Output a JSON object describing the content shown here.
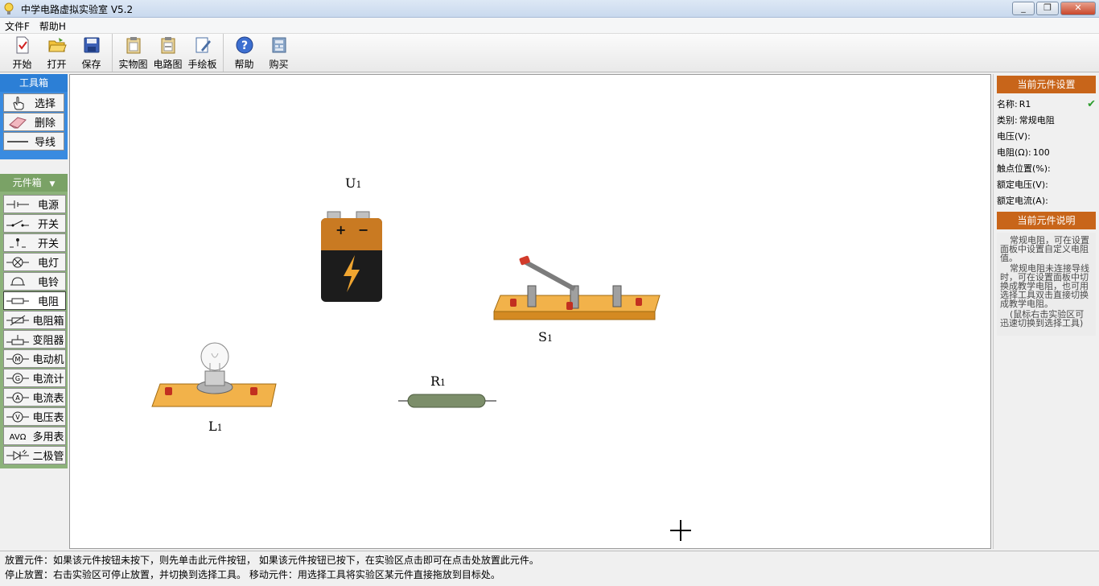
{
  "window": {
    "title": "中学电路虚拟实验室 V5.2",
    "buttons": [
      "_",
      "❐",
      "✕"
    ]
  },
  "menu": [
    "文件F",
    "帮助H"
  ],
  "toolbar": {
    "group1": [
      {
        "label": "开始",
        "icon": "new-doc-icon"
      },
      {
        "label": "打开",
        "icon": "open-folder-icon"
      },
      {
        "label": "保存",
        "icon": "save-disk-icon"
      }
    ],
    "group2": [
      {
        "label": "实物图",
        "icon": "clipboard-icon"
      },
      {
        "label": "电路图",
        "icon": "circuit-clipboard-icon"
      },
      {
        "label": "手绘板",
        "icon": "draw-board-icon"
      }
    ],
    "group3": [
      {
        "label": "帮助",
        "icon": "help-icon"
      },
      {
        "label": "购买",
        "icon": "buy-icon"
      }
    ]
  },
  "toolbox": {
    "title": "工具箱",
    "items": [
      {
        "label": "选择",
        "icon": "hand-pointer-icon"
      },
      {
        "label": "删除",
        "icon": "eraser-icon"
      },
      {
        "label": "导线",
        "icon": "wire-line-icon"
      }
    ]
  },
  "partbox": {
    "title": "元件箱",
    "items": [
      {
        "label": "电源",
        "icon": "battery-symbol-icon"
      },
      {
        "label": "开关",
        "icon": "switch-symbol-icon"
      },
      {
        "label": "开关",
        "icon": "push-switch-icon"
      },
      {
        "label": "电灯",
        "icon": "lamp-symbol-icon"
      },
      {
        "label": "电铃",
        "icon": "bell-symbol-icon"
      },
      {
        "label": "电阻",
        "icon": "resistor-symbol-icon"
      },
      {
        "label": "电阻箱",
        "icon": "resistor-box-icon"
      },
      {
        "label": "变阻器",
        "icon": "rheostat-icon"
      },
      {
        "label": "电动机",
        "icon": "motor-symbol-icon"
      },
      {
        "label": "电流计",
        "icon": "galvanometer-icon"
      },
      {
        "label": "电流表",
        "icon": "ammeter-icon"
      },
      {
        "label": "电压表",
        "icon": "voltmeter-icon"
      },
      {
        "label": "多用表",
        "icon": "multimeter-icon"
      },
      {
        "label": "二极管",
        "icon": "diode-icon"
      }
    ]
  },
  "components": {
    "battery": {
      "name": "U",
      "sub": "1"
    },
    "switch": {
      "name": "S",
      "sub": "1"
    },
    "lamp": {
      "name": "L",
      "sub": "1"
    },
    "resistor": {
      "name": "R",
      "sub": "1"
    }
  },
  "properties": {
    "header": "当前元件设置",
    "rows": [
      {
        "label": "名称:",
        "value": "R1"
      },
      {
        "label": "类别:",
        "value": "常规电阻"
      },
      {
        "label": "电压(V):",
        "value": ""
      },
      {
        "label": "电阻(Ω):",
        "value": "100"
      },
      {
        "label": "触点位置(%):",
        "value": ""
      },
      {
        "label": "额定电压(V):",
        "value": ""
      },
      {
        "label": "额定电流(A):",
        "value": ""
      }
    ]
  },
  "description": {
    "header": "当前元件说明",
    "paragraphs": [
      "常规电阻，可在设置面板中设置自定义电阻值。",
      "常规电阻未连接导线时，可在设置面板中切换成教学电阻，也可用选择工具双击直接切换成教学电阻。",
      "(鼠标右击实验区可迅速切换到选择工具)"
    ]
  },
  "status": {
    "line1": "放置元件：如果该元件按钮未按下，则先单击此元件按钮，  如果该元件按钮已按下，在实验区点击即可在点击处放置此元件。",
    "line2": "停止放置：右击实验区可停止放置，并切换到选择工具。  移动元件：用选择工具将实验区某元件直接拖放到目标处。"
  },
  "colors": {
    "toolbox_blue": "#2c7fd6",
    "partbox_green": "#8cb27a",
    "orange_header": "#c8651a"
  }
}
